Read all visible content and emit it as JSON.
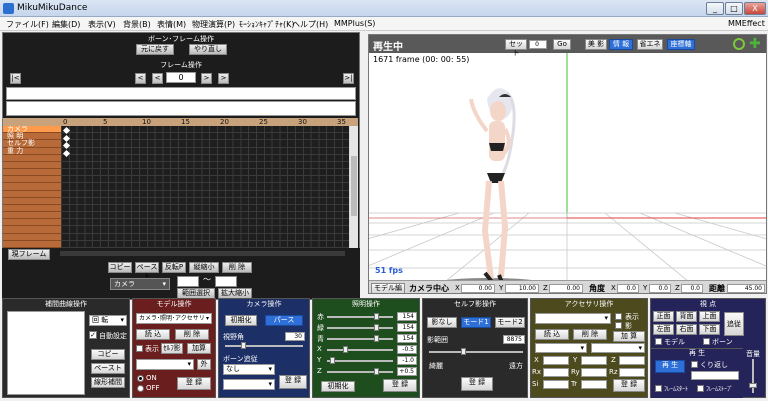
{
  "window": {
    "title": "MikuMikuDance",
    "btn_min": "_",
    "btn_max": "□",
    "btn_close": "X"
  },
  "menu": {
    "items": [
      "ファイル(F)",
      "編集(D)",
      "表示(V)",
      "背景(B)",
      "表情(M)",
      "物理演算(P)",
      "ﾓｰｼｮﾝｷｬﾌﾟﾁｬ(K)",
      "ヘルプ(H)",
      "MMPlus(S)"
    ],
    "right": "MMEffect"
  },
  "bone_frame": {
    "header": "ボーン･フレーム操作",
    "undo": "元に戻す",
    "redo": "やり直し",
    "frame_header": "フレーム操作",
    "frame_value": "0",
    "nav_first": "|<",
    "nav_prev_key": "<",
    "nav_prev": "<",
    "nav_next": ">",
    "nav_next_key": ">",
    "nav_last": ">|"
  },
  "timeline": {
    "ticks": [
      "0",
      "5",
      "10",
      "15",
      "20",
      "25",
      "30",
      "35"
    ],
    "rows": [
      "カメラ",
      "照 明",
      "セルフ影",
      "重 力",
      "",
      "",
      "",
      "",
      "",
      "",
      "",
      "",
      "",
      "",
      "",
      "",
      ""
    ],
    "play_frame": "現フレーム"
  },
  "left_bottom": {
    "copy": "コピー",
    "paste": "ペースト",
    "reverse": "反転P",
    "scale": "縦縮小",
    "delete": "削 除",
    "camera_select": "カメラ",
    "tilde": "～",
    "range_select": "範囲選択",
    "expand": "拡大縮小"
  },
  "viewport": {
    "status": "再生中",
    "frame_info": "1671 frame (00: 00: 55)",
    "set_label": "セット",
    "set_value": "0",
    "go": "Go",
    "beauty": "美 影",
    "info": "情 報",
    "eco": "省エネ",
    "sit": "座標軸",
    "fps": "51 fps",
    "model_edit": "モデル編",
    "camera_center": "カメラ中心",
    "cx_label": "X",
    "cx": "0.00",
    "cy_label": "Y",
    "cy": "10.00",
    "cz_label": "Z",
    "cz": "0.00",
    "angle": "角度",
    "ax_label": "X",
    "ax": "0.0",
    "ay_label": "Y",
    "ay": "0.0",
    "az_label": "Z",
    "az": "0.0",
    "distance": "距離",
    "dist": "45.00"
  },
  "interp": {
    "header": "補間曲線操作",
    "rotate": "回 転",
    "auto": "自動設定",
    "copy": "コピー",
    "paste": "ペースト",
    "linear": "線形補間"
  },
  "model": {
    "header": "モデル操作",
    "select": "カメラ･照明･アクセサリ",
    "load": "読 込",
    "delete": "削 除",
    "display": "表示",
    "shadow": "ｾﾙﾌ影",
    "add": "加算",
    "outside": "外",
    "on": "ON",
    "off": "OFF",
    "register": "登 録"
  },
  "camera": {
    "header": "カメラ操作",
    "init": "初期化",
    "perspective": "パース",
    "fov_label": "視野角",
    "fov": "30",
    "follow_label": "ボーン追従",
    "follow": "なし",
    "register": "登 録"
  },
  "light": {
    "header": "照明操作",
    "r_label": "赤",
    "r": "154",
    "g_label": "緑",
    "g": "154",
    "b_label": "青",
    "b": "154",
    "x_label": "X",
    "x": "-0.5",
    "y_label": "Y",
    "y": "-1.0",
    "z_label": "Z",
    "z": "+0.5",
    "init": "初期化",
    "register": "登 録"
  },
  "selfshadow": {
    "header": "セルフ影操作",
    "none": "影なし",
    "mode1": "モード1",
    "mode2": "モード2",
    "range_label": "影範囲",
    "range": "8875",
    "near": "綺麗",
    "far": "遠方",
    "register": "登 録"
  },
  "accessory": {
    "header": "アクセサリ操作",
    "display": "表示",
    "shadow": "影",
    "load": "読 込",
    "delete": "削 除",
    "add": "加 算",
    "x_label": "X",
    "y_label": "Y",
    "z_label": "Z",
    "rx_label": "Rx",
    "ry_label": "Ry",
    "rz_label": "Rz",
    "si_label": "Si",
    "tr_label": "Tr",
    "register": "登 録"
  },
  "view": {
    "header": "視 点",
    "front": "正面",
    "back": "背面",
    "top": "上面",
    "left": "左面",
    "right": "右面",
    "bottom": "下面",
    "track": "追従",
    "model": "モデル",
    "bone": "ボーン"
  },
  "play": {
    "header": "再 生",
    "play": "再 生",
    "repeat": "くり返し",
    "frame_stop": "ﾌﾚｰﾑｽﾄｰﾌﾟ",
    "frame_start": "ﾌﾚｰﾑｽﾀｰﾄ",
    "volume": "音量"
  },
  "colors": {
    "dark_panel": "#1c1c1c",
    "panel_model": "#6b1e1e",
    "panel_camera": "#1c2f66",
    "panel_light": "#1e4d1e",
    "panel_shadow": "#2a2a2a",
    "panel_accessory": "#4d4a1e",
    "panel_view": "#24245a",
    "accent_blue": "#2e6fd8"
  }
}
